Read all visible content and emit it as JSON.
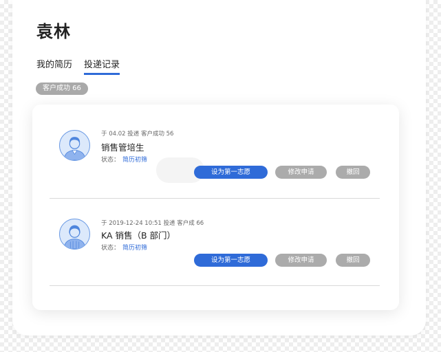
{
  "profile": {
    "name": "袁林"
  },
  "tabs": [
    {
      "label": "我的简历",
      "active": false
    },
    {
      "label": "投递记录",
      "active": true
    }
  ],
  "stats": {
    "badge_label": "客户成功 66"
  },
  "colors": {
    "accent": "#2f6bd8",
    "button_gray": "#ababab",
    "badge_gray": "#a9a9a9"
  },
  "records": [
    {
      "meta": "于 04.02  投递  客户成功 56",
      "title": "销售管培生",
      "status_label": "状态：",
      "status_value": "简历初筛",
      "avatar_icon": "male-avatar-icon",
      "actions": {
        "primary": "设为第一志愿",
        "modify": "修改申请",
        "withdraw": "撤回"
      }
    },
    {
      "meta": "于 2019-12-24  10:51  投递  客户成 66",
      "title": "KA 销售（B 部门）",
      "status_label": "状态：",
      "status_value": "简历初筛",
      "avatar_icon": "female-avatar-icon",
      "actions": {
        "primary": "设为第一志愿",
        "modify": "修改申请",
        "withdraw": "撤回"
      }
    }
  ]
}
